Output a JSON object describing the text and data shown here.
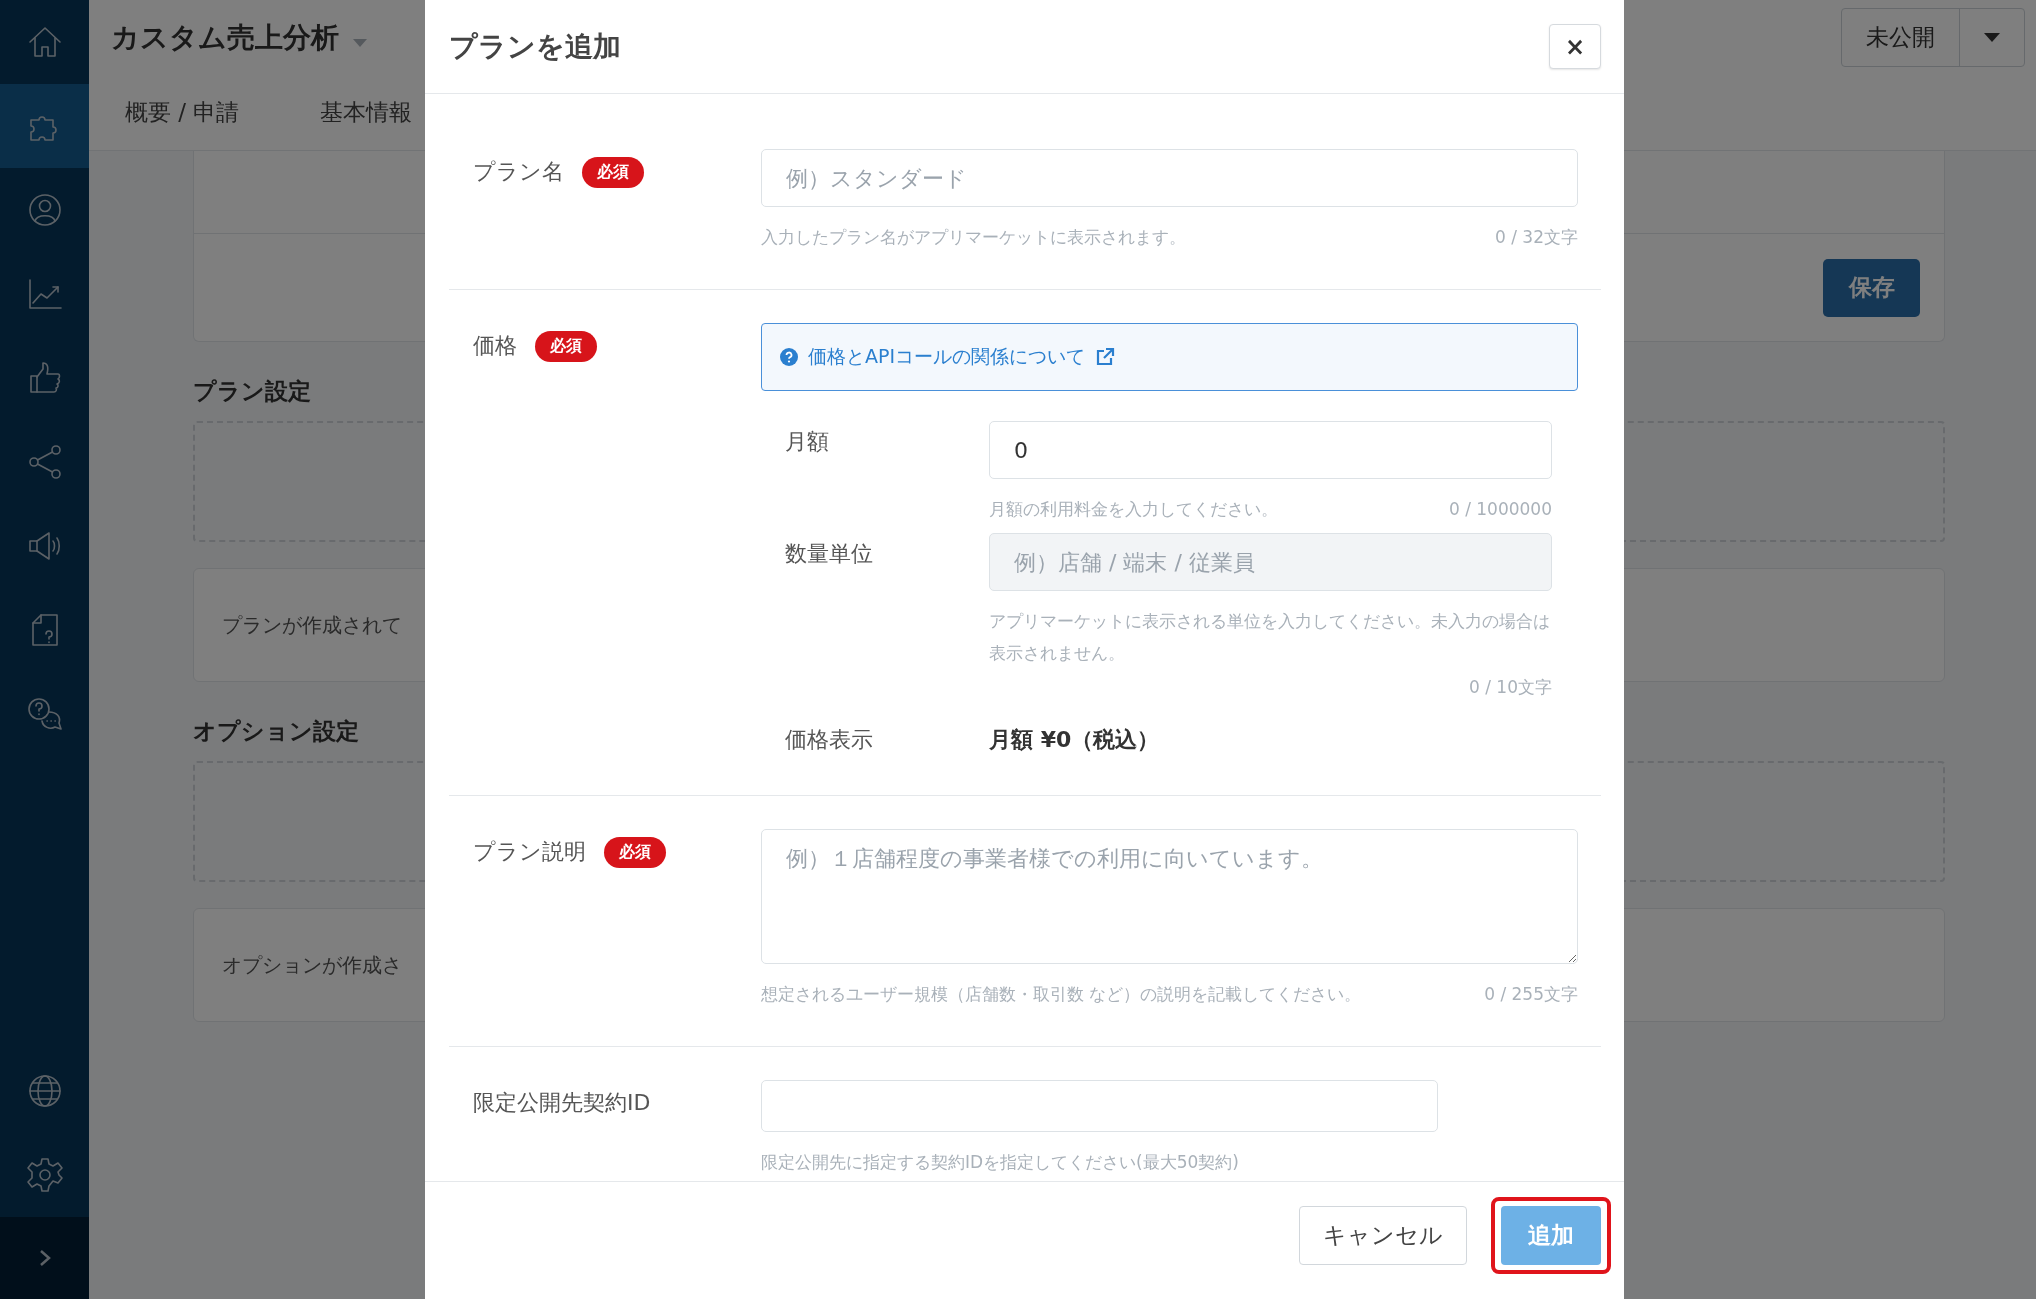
{
  "sidebar": {
    "items": [
      {
        "kind": "home",
        "selected": false
      },
      {
        "kind": "puzzle",
        "selected": true
      },
      {
        "kind": "user",
        "selected": false
      },
      {
        "kind": "chart",
        "selected": false
      },
      {
        "kind": "thumb",
        "selected": false
      },
      {
        "kind": "share",
        "selected": false
      },
      {
        "kind": "megaphone",
        "selected": false
      },
      {
        "kind": "doc-question",
        "selected": false
      },
      {
        "kind": "chat",
        "selected": false
      }
    ],
    "bottom_items": [
      {
        "kind": "globe",
        "selected": false
      },
      {
        "kind": "gear",
        "selected": false
      }
    ]
  },
  "app_header": {
    "title": "カスタム売上分析",
    "tabs": [
      {
        "label": "概要 / 申請"
      },
      {
        "label": "基本情報"
      }
    ],
    "status_button": "未公開"
  },
  "content": {
    "save_button": "保存",
    "sections": [
      {
        "heading": "プラン設定",
        "empty_message": "プランが作成されて"
      },
      {
        "heading": "オプション設定",
        "empty_message": "オプションが作成さ"
      }
    ]
  },
  "dialog": {
    "title": "プランを追加",
    "close": "×",
    "fields": [
      {
        "kind": "text",
        "label": "プラン名",
        "required_badge": "必須",
        "placeholder": "例）スタンダード",
        "hint": "入力したプラン名がアプリマーケットに表示されます。",
        "counter": "0 / 32文字"
      },
      {
        "kind": "price",
        "label": "価格",
        "required_badge": "必須",
        "info_link": "価格とAPIコールの関係について",
        "subfields": [
          {
            "kind": "input",
            "label": "月額",
            "value": "0",
            "hint": "月額の利用料金を入力してください。",
            "counter": "0 / 1000000",
            "disabled": false
          },
          {
            "kind": "input",
            "label": "数量単位",
            "placeholder": "例）店舗 / 端末 / 従業員",
            "hint": "アプリマーケットに表示される単位を入力してください。未入力の場合は表示されません。",
            "counter": "0 / 10文字",
            "disabled": true
          },
          {
            "kind": "display",
            "label": "価格表示",
            "value": "月額 ¥0（税込）"
          }
        ]
      },
      {
        "kind": "textarea",
        "label": "プラン説明",
        "required_badge": "必須",
        "placeholder": "例）１店舗程度の事業者様での利用に向いています。",
        "hint": "想定されるユーザー規模（店舗数・取引数 など）の説明を記載してください。",
        "counter": "0 / 255文字"
      },
      {
        "kind": "short",
        "label": "限定公開先契約ID",
        "hint": "限定公開先に指定する契約IDを指定してください(最大50契約)"
      }
    ],
    "buttons": [
      {
        "kind": "secondary",
        "label": "キャンセル",
        "highlighted": false
      },
      {
        "kind": "primary",
        "label": "追加",
        "highlighted": true
      }
    ]
  }
}
